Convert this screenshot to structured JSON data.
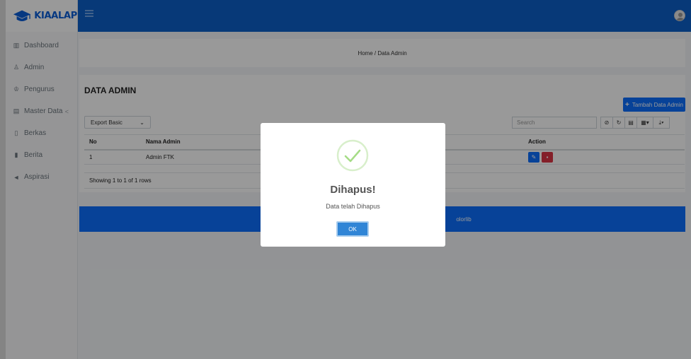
{
  "brand": {
    "name": "KIAALAP"
  },
  "sidebar": {
    "items": [
      {
        "label": "Dashboard",
        "icon": "chart-icon"
      },
      {
        "label": "Admin",
        "icon": "user-icon"
      },
      {
        "label": "Pengurus",
        "icon": "user-tie-icon"
      },
      {
        "label": "Master Data",
        "icon": "folder-icon",
        "arrow": "<"
      },
      {
        "label": "Berkas",
        "icon": "file-icon"
      },
      {
        "label": "Berita",
        "icon": "news-icon"
      },
      {
        "label": "Aspirasi",
        "icon": "megaphone-icon"
      }
    ]
  },
  "breadcrumb": {
    "text": "Home / Data Admin"
  },
  "card": {
    "title": "DATA ADMIN",
    "add_button": "Tambah Data Admin",
    "export_select": "Export Basic",
    "search_placeholder": "Search"
  },
  "table": {
    "headers": {
      "no": "No",
      "name": "Nama Admin",
      "action": "Action"
    },
    "rows": [
      {
        "no": "1",
        "name": "Admin FTK"
      }
    ],
    "footer": "Showing 1 to 1 of 1 rows"
  },
  "footer": {
    "text": "olorlib"
  },
  "modal": {
    "title": "Dihapus!",
    "message": "Data telah Dihapus",
    "ok_label": "OK"
  },
  "colors": {
    "primary": "#0d6efd",
    "topbar": "#0d5fc9",
    "danger": "#dc3545",
    "success": "#a5dc86",
    "confirm": "#3085d6"
  }
}
